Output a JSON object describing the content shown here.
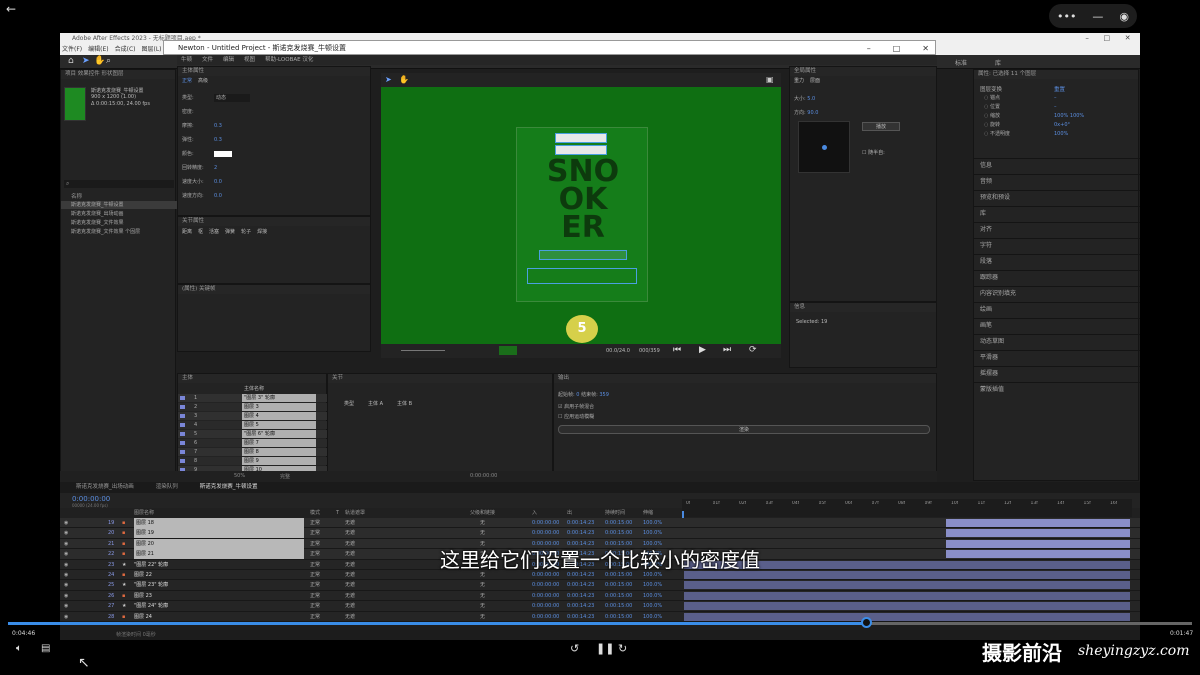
{
  "player": {
    "time_current": "0:04:46",
    "time_total": "0:01:47",
    "progress_fraction": 0.725,
    "subtitle": "这里给它们设置一个比较小的密度值",
    "watermark_cn": "摄影前沿",
    "watermark_url": "sheyingzyz.com"
  },
  "ae": {
    "title": "Adobe After Effects 2023 - 无标题项目.aep *",
    "menu": [
      "文件(F)",
      "编辑(E)",
      "合成(C)",
      "图层(L)",
      "效"
    ],
    "workspace_tabs": [
      "标准",
      "库"
    ]
  },
  "newton": {
    "title": "Newton - Untitled Project - 斯诺克发烧赛_牛顿设置",
    "menu": [
      "牛顿",
      "文件",
      "编辑",
      "视图",
      "帮助-LOOBAE 汉化"
    ]
  },
  "project": {
    "tabs": [
      "项目",
      "效果控件 形状图层"
    ],
    "comp_name": "斯诺克发烧赛_牛顿设置",
    "comp_info1": "900 x 1200 (1.00)",
    "comp_info2": "Δ 0:00:15:00, 24.00 fps",
    "col_name": "名称",
    "items": [
      "斯诺克发烧赛_牛顿设置",
      "斯诺克发烧赛_出场动画",
      "斯诺克发烧赛_文件效果",
      "斯诺克发烧赛_文件效果 个固层"
    ]
  },
  "body_props": {
    "header": "主体属性",
    "tabs": [
      "正常",
      "高级"
    ],
    "rows": [
      {
        "label": "类型:",
        "value": "动态"
      },
      {
        "label": "密度:",
        "value": ""
      },
      {
        "label": "摩擦:",
        "value": "0.3"
      },
      {
        "label": "弹性:",
        "value": "0.3"
      },
      {
        "label": "颜色:",
        "value": ""
      },
      {
        "label": "回转精度:",
        "value": "2"
      },
      {
        "label": "速度大小:",
        "value": "0.0"
      },
      {
        "label": "速度方向:",
        "value": "0.0"
      }
    ]
  },
  "joint_props": {
    "header": "关节属性",
    "tabs": [
      "距离",
      "枢",
      "活塞",
      "弹簧",
      "轮子",
      "焊接"
    ],
    "header2": "(属性) 关键帧"
  },
  "bodies_panel": {
    "header": "主体",
    "col": "主体名称",
    "rows": [
      {
        "n": "1",
        "name": "\"图层 3\" 轮廓"
      },
      {
        "n": "2",
        "name": "图层 3"
      },
      {
        "n": "3",
        "name": "图层 4"
      },
      {
        "n": "4",
        "name": "图层 5"
      },
      {
        "n": "5",
        "name": "\"图层 6\" 轮廓"
      },
      {
        "n": "6",
        "name": "图层 7"
      },
      {
        "n": "7",
        "name": "图层 8"
      },
      {
        "n": "8",
        "name": "图层 9"
      },
      {
        "n": "9",
        "name": "图层 10"
      }
    ]
  },
  "joints_panel": {
    "header": "关节",
    "cols": [
      "类型",
      "主体 A",
      "主体 B"
    ]
  },
  "export_panel": {
    "header": "输出",
    "start_label": "起始帧:",
    "start_val": "0",
    "end_label": "结束帧:",
    "end_val": "359",
    "check1": "启用子帧混合",
    "check2": "应用运动模糊",
    "render": "渲染"
  },
  "global_props": {
    "header": "全局属性",
    "tabs": [
      "重力",
      "层面"
    ],
    "gravity_label": "大小:",
    "gravity_val": "5.0",
    "dir_label": "方向:",
    "dir_val": "90.0",
    "btn": "播放",
    "checkbox": "随半自:",
    "info_header": "信息",
    "info_text": "Selected: 19"
  },
  "viewer": {
    "poster_line1": "SNO",
    "poster_line2": "OK",
    "poster_line3": "ER",
    "coin": "5",
    "time": "00.0/24.0",
    "frames": "000/359",
    "zoom": "50%",
    "view": "完整",
    "timecode": "0:00:00:00"
  },
  "right_panel": {
    "header": "属性: 已选择 11 个图层",
    "section": "图层变换",
    "reset": "重置",
    "props": [
      {
        "label": "锚点",
        "value": "–"
      },
      {
        "label": "位置",
        "value": "–"
      },
      {
        "label": "缩放",
        "value": "100%  100%"
      },
      {
        "label": "旋转",
        "value": "0x+0°"
      },
      {
        "label": "不透明度",
        "value": "100%"
      }
    ],
    "list": [
      "信息",
      "音频",
      "预览和预设",
      "库",
      "对齐",
      "字符",
      "段落",
      "跟踪器",
      "内容识别填充",
      "绘画",
      "画笔",
      "动态草图",
      "平滑器",
      "摇摆器",
      "蒙版插值"
    ]
  },
  "timeline": {
    "tabs": [
      "斯诺克发烧赛_出场动画",
      "渲染队列",
      "斯诺克发烧赛_牛顿设置"
    ],
    "timecode": "0:00:00:00",
    "frame_info": "00000 (24.00 fps)",
    "cols": [
      "图层名称",
      "模式",
      "T",
      "轨道遮罩",
      "父级和链接",
      "入",
      "出",
      "持续时间",
      "伸缩"
    ],
    "ruler": [
      "0f",
      "01f",
      "02f",
      "03f",
      "04f",
      "05f",
      "06f",
      "07f",
      "08f",
      "09f",
      "10f",
      "11f",
      "12f",
      "13f",
      "14f",
      "15f",
      "16f"
    ],
    "rows": [
      {
        "n": "19",
        "name": "图层 18",
        "star": false
      },
      {
        "n": "20",
        "name": "图层 19",
        "star": false
      },
      {
        "n": "21",
        "name": "图层 20",
        "star": false
      },
      {
        "n": "22",
        "name": "图层 21",
        "star": false
      },
      {
        "n": "23",
        "name": "\"图层 22\" 轮廓",
        "star": true
      },
      {
        "n": "24",
        "name": "图层 22",
        "star": false
      },
      {
        "n": "25",
        "name": "\"图层 23\" 轮廓",
        "star": true
      },
      {
        "n": "26",
        "name": "图层 23",
        "star": false
      },
      {
        "n": "27",
        "name": "\"图层 24\" 轮廓",
        "star": true
      },
      {
        "n": "28",
        "name": "图层 24",
        "star": false
      }
    ],
    "mode": "正常",
    "matte": "无遮",
    "parent": "无",
    "in": "0:00:00:00",
    "out": "0:00:14:23",
    "dur": "0:00:15:00",
    "stretch": "100.0%",
    "footer": "帧渲染时间  0毫秒"
  }
}
